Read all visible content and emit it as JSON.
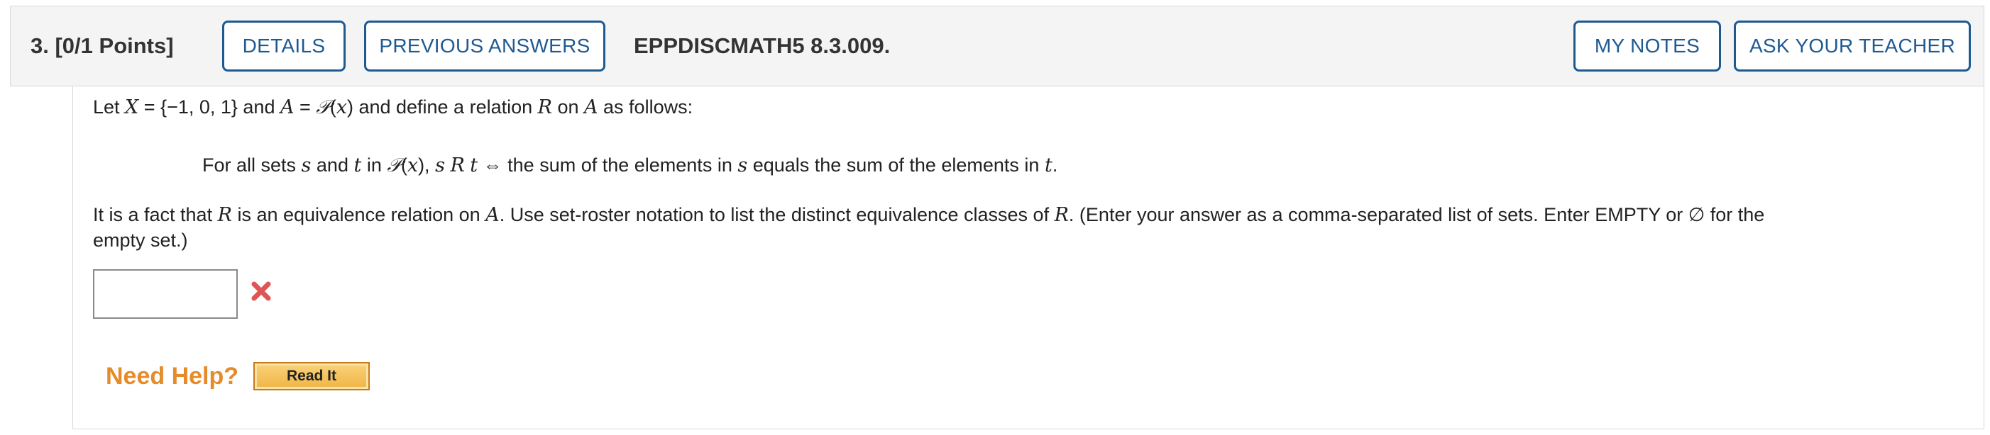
{
  "header": {
    "question_number": "3.",
    "points": "[0/1 Points]",
    "details_label": "DETAILS",
    "previous_answers_label": "PREVIOUS ANSWERS",
    "question_code": "EPPDISCMATH5 8.3.009.",
    "my_notes_label": "MY NOTES",
    "ask_teacher_label": "ASK YOUR TEACHER"
  },
  "question": {
    "line1": {
      "t1": "Let ",
      "x1": "X",
      "t2": " = {−1, 0, 1} and ",
      "a1": "A",
      "t3": " = ",
      "p1": "𝒫",
      "t4": "(",
      "x2": "x",
      "t5": ") and define a relation ",
      "r1": "R",
      "t6": " on ",
      "a2": "A",
      "t7": " as follows:"
    },
    "line2": {
      "t1": "For all sets ",
      "s1": "s",
      "t2": " and ",
      "tt1": "t",
      "t3": " in ",
      "p1": "𝒫",
      "t4": "(",
      "x1": "x",
      "t5": "), ",
      "s2": "s",
      "t6": " ",
      "r1": "R",
      "t7": " ",
      "tt2": "t",
      "t8": "  ⇔  the sum of the elements in ",
      "s3": "s",
      "t9": " equals the sum of the elements in ",
      "tt3": "t",
      "t10": "."
    },
    "line3": {
      "t1": "It is a fact that ",
      "r1": "R",
      "t2": " is an equivalence relation on ",
      "a1": "A",
      "t3": ". Use set-roster notation to list the distinct equivalence classes of ",
      "r2": "R",
      "t4": ". (Enter your answer as a comma-separated list of sets. Enter EMPTY or ∅ for the"
    },
    "line4": "empty set.)"
  },
  "answer": {
    "value": "",
    "status_icon": "x-mark-icon",
    "status_color": "#e05555"
  },
  "help": {
    "label": "Need Help?",
    "read_it_label": "Read It"
  },
  "colors": {
    "accent": "#1d5a92",
    "help": "#e58b2a"
  }
}
